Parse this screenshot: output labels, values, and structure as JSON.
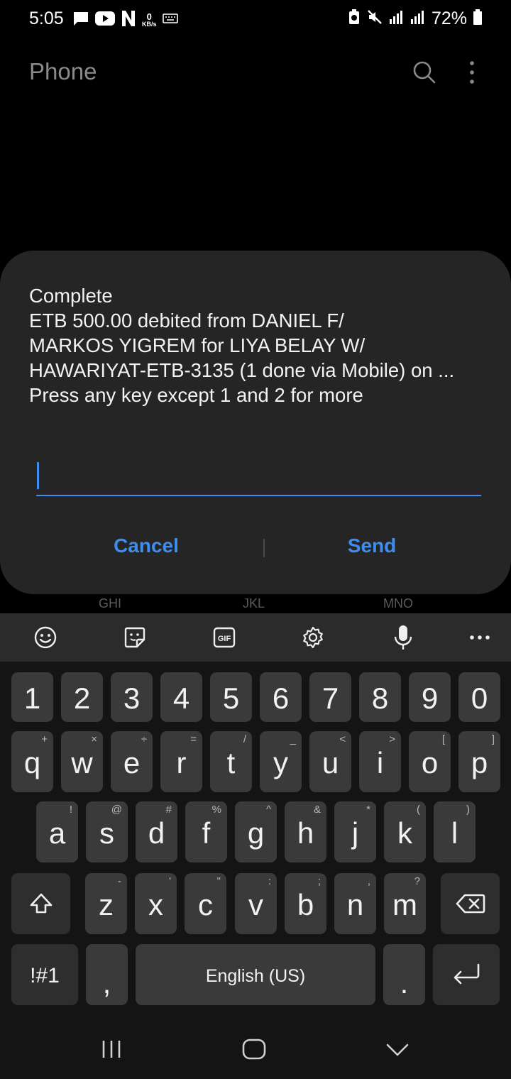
{
  "status_bar": {
    "time": "5:05",
    "net_speed_value": "0",
    "net_speed_unit": "KB/s",
    "battery": "72%"
  },
  "app": {
    "title": "Phone"
  },
  "dialog": {
    "lines": [
      "Complete",
      "ETB 500.00 debited from DANIEL F/",
      "MARKOS YIGREM for LIYA BELAY W/",
      "HAWARIYAT-ETB-3135 (1 done via Mobile) on ...",
      "Press any key except 1 and 2 for more"
    ],
    "input_value": "",
    "cancel_label": "Cancel",
    "send_label": "Send"
  },
  "dialpad_hints": [
    "GHI",
    "JKL",
    "MNO"
  ],
  "keyboard": {
    "toolbar_icons": [
      "emoji-icon",
      "sticker-icon",
      "gif-icon",
      "settings-icon",
      "mic-icon",
      "more-icon"
    ],
    "gif_label": "GIF",
    "numbers": [
      "1",
      "2",
      "3",
      "4",
      "5",
      "6",
      "7",
      "8",
      "9",
      "0"
    ],
    "row1": [
      {
        "k": "q",
        "h": "+"
      },
      {
        "k": "w",
        "h": "×"
      },
      {
        "k": "e",
        "h": "÷"
      },
      {
        "k": "r",
        "h": "="
      },
      {
        "k": "t",
        "h": "/"
      },
      {
        "k": "y",
        "h": "_"
      },
      {
        "k": "u",
        "h": "<"
      },
      {
        "k": "i",
        "h": ">"
      },
      {
        "k": "o",
        "h": "["
      },
      {
        "k": "p",
        "h": "]"
      }
    ],
    "row2": [
      {
        "k": "a",
        "h": "!"
      },
      {
        "k": "s",
        "h": "@"
      },
      {
        "k": "d",
        "h": "#"
      },
      {
        "k": "f",
        "h": "%"
      },
      {
        "k": "g",
        "h": "^"
      },
      {
        "k": "h",
        "h": "&"
      },
      {
        "k": "j",
        "h": "*"
      },
      {
        "k": "k",
        "h": "("
      },
      {
        "k": "l",
        "h": ")"
      }
    ],
    "row3": [
      {
        "k": "z",
        "h": "-"
      },
      {
        "k": "x",
        "h": "'"
      },
      {
        "k": "c",
        "h": "\""
      },
      {
        "k": "v",
        "h": ":"
      },
      {
        "k": "b",
        "h": ";"
      },
      {
        "k": "n",
        "h": ","
      },
      {
        "k": "m",
        "h": "?"
      }
    ],
    "symbols_label": "!#1",
    "comma_label": ",",
    "space_label": "English (US)",
    "period_label": "."
  }
}
